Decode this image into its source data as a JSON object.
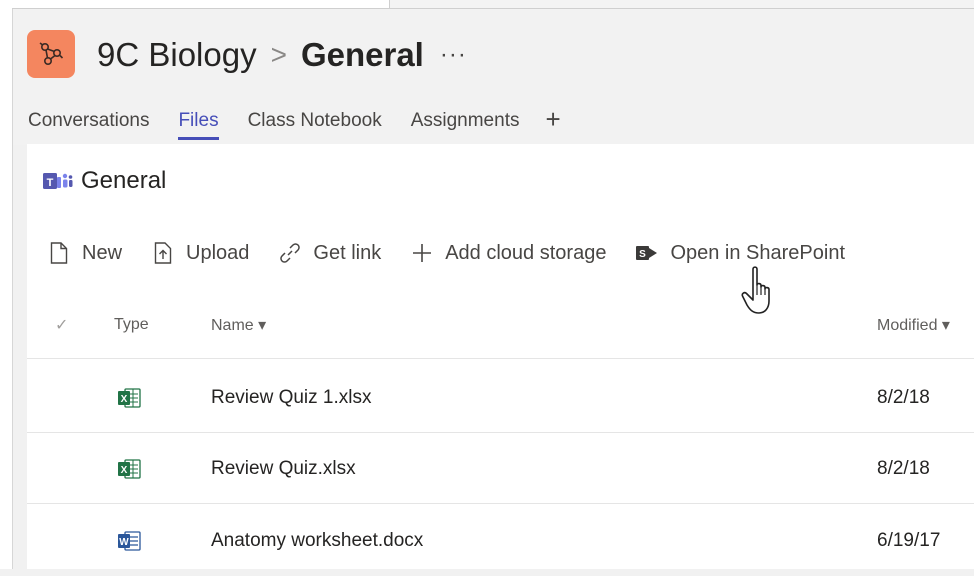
{
  "header": {
    "team_name": "9C Biology",
    "separator": ">",
    "channel_name": "General",
    "more": "···"
  },
  "tabs": [
    {
      "label": "Conversations",
      "active": false
    },
    {
      "label": "Files",
      "active": true
    },
    {
      "label": "Class Notebook",
      "active": false
    },
    {
      "label": "Assignments",
      "active": false
    }
  ],
  "add_tab": "+",
  "library": {
    "title": "General"
  },
  "toolbar": {
    "new_label": "New",
    "upload_label": "Upload",
    "get_link_label": "Get link",
    "add_cloud_label": "Add cloud storage",
    "open_sharepoint_label": "Open in SharePoint"
  },
  "table": {
    "columns": {
      "select": "✓",
      "type": "Type",
      "name": "Name ▾",
      "modified": "Modified ▾"
    },
    "rows": [
      {
        "type_icon": "excel-icon",
        "name": "Review Quiz 1.xlsx",
        "modified": "8/2/18"
      },
      {
        "type_icon": "excel-icon",
        "name": "Review Quiz.xlsx",
        "modified": "8/2/18"
      },
      {
        "type_icon": "word-icon",
        "name": "Anatomy worksheet.docx",
        "modified": "6/19/17"
      }
    ]
  },
  "colors": {
    "accent": "#464eb8",
    "team_avatar": "#f4865f",
    "excel": "#217346",
    "word": "#2b579a"
  }
}
